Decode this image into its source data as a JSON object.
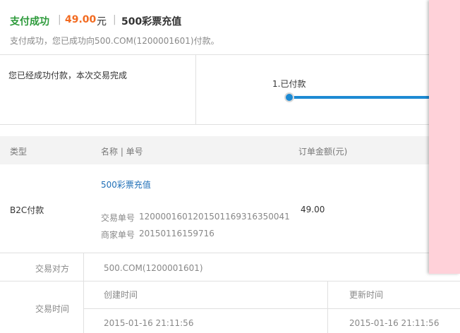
{
  "header": {
    "status": "支付成功",
    "separator": "|",
    "amount": "49.00",
    "currency": "元",
    "product": "500彩票充值",
    "subtitle": "支付成功，您已成功向500.COM(1200001601)付款。"
  },
  "status_row": {
    "message": "您已经成功付款，本次交易完成",
    "progress_step": "1.已付款"
  },
  "order_table": {
    "headers": [
      "类型",
      "名称 | 单号",
      "订单金额(元)"
    ],
    "row": {
      "type": "B2C付款",
      "product": "500彩票充值",
      "trade_no_label": "交易单号",
      "trade_no": "1200001601201501169316350041",
      "merchant_no_label": "商家单号",
      "merchant_no": "20150116159716",
      "amount": "49.00"
    }
  },
  "details": {
    "counterparty_label": "交易对方",
    "counterparty": "500.COM(1200001601)",
    "time_label": "交易时间",
    "created_label": "创建时间",
    "updated_label": "更新时间",
    "created": "2015-01-16 21:11:56",
    "updated": "2015-01-16 21:11:56"
  },
  "colors": {
    "success": "#2c9a3a",
    "amount": "#f26b21",
    "link": "#1f6fb7",
    "progress": "#1d8ad3",
    "overlay": "#ffd1d9"
  }
}
